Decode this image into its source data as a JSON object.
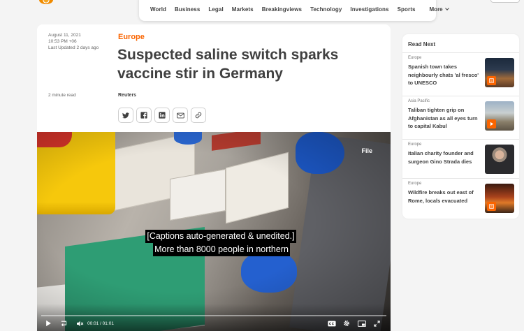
{
  "nav": {
    "items": [
      "World",
      "Business",
      "Legal",
      "Markets",
      "Breakingviews",
      "Technology",
      "Investigations",
      "Sports"
    ],
    "more_label": "More"
  },
  "article": {
    "date": "August 11, 2021",
    "time": "10:53 PM +06",
    "last_updated": "Last Updated 2 days ago",
    "read_time": "2 minute read",
    "section": "Europe",
    "headline": "Suspected saline switch sparks vaccine stir in Germany",
    "byline": "Reuters",
    "share_icons": [
      "twitter-icon",
      "facebook-icon",
      "linkedin-icon",
      "email-icon",
      "link-icon"
    ]
  },
  "video": {
    "file_tag": "File",
    "caption_line1": "[Captions auto-generated & unedited.]",
    "caption_line2": "More than 8000 people in northern",
    "time_display": "00:01 / 01:01"
  },
  "read_next": {
    "title": "Read Next",
    "items": [
      {
        "kicker": "Europe",
        "title": "Spanish town takes neighbourly chats 'al fresco' to UNESCO",
        "media": "article"
      },
      {
        "kicker": "Asia Pacific",
        "title": "Taliban tighten grip on Afghanistan as all eyes turn to capital Kabul",
        "media": "video"
      },
      {
        "kicker": "Europe",
        "title": "Italian charity founder and surgeon Gino Strada dies",
        "media": "none"
      },
      {
        "kicker": "Europe",
        "title": "Wildfire breaks out east of Rome, locals evacuated",
        "media": "article"
      }
    ]
  },
  "colors": {
    "accent": "#fa6400",
    "text": "#404040",
    "background": "#f4f4f4"
  }
}
